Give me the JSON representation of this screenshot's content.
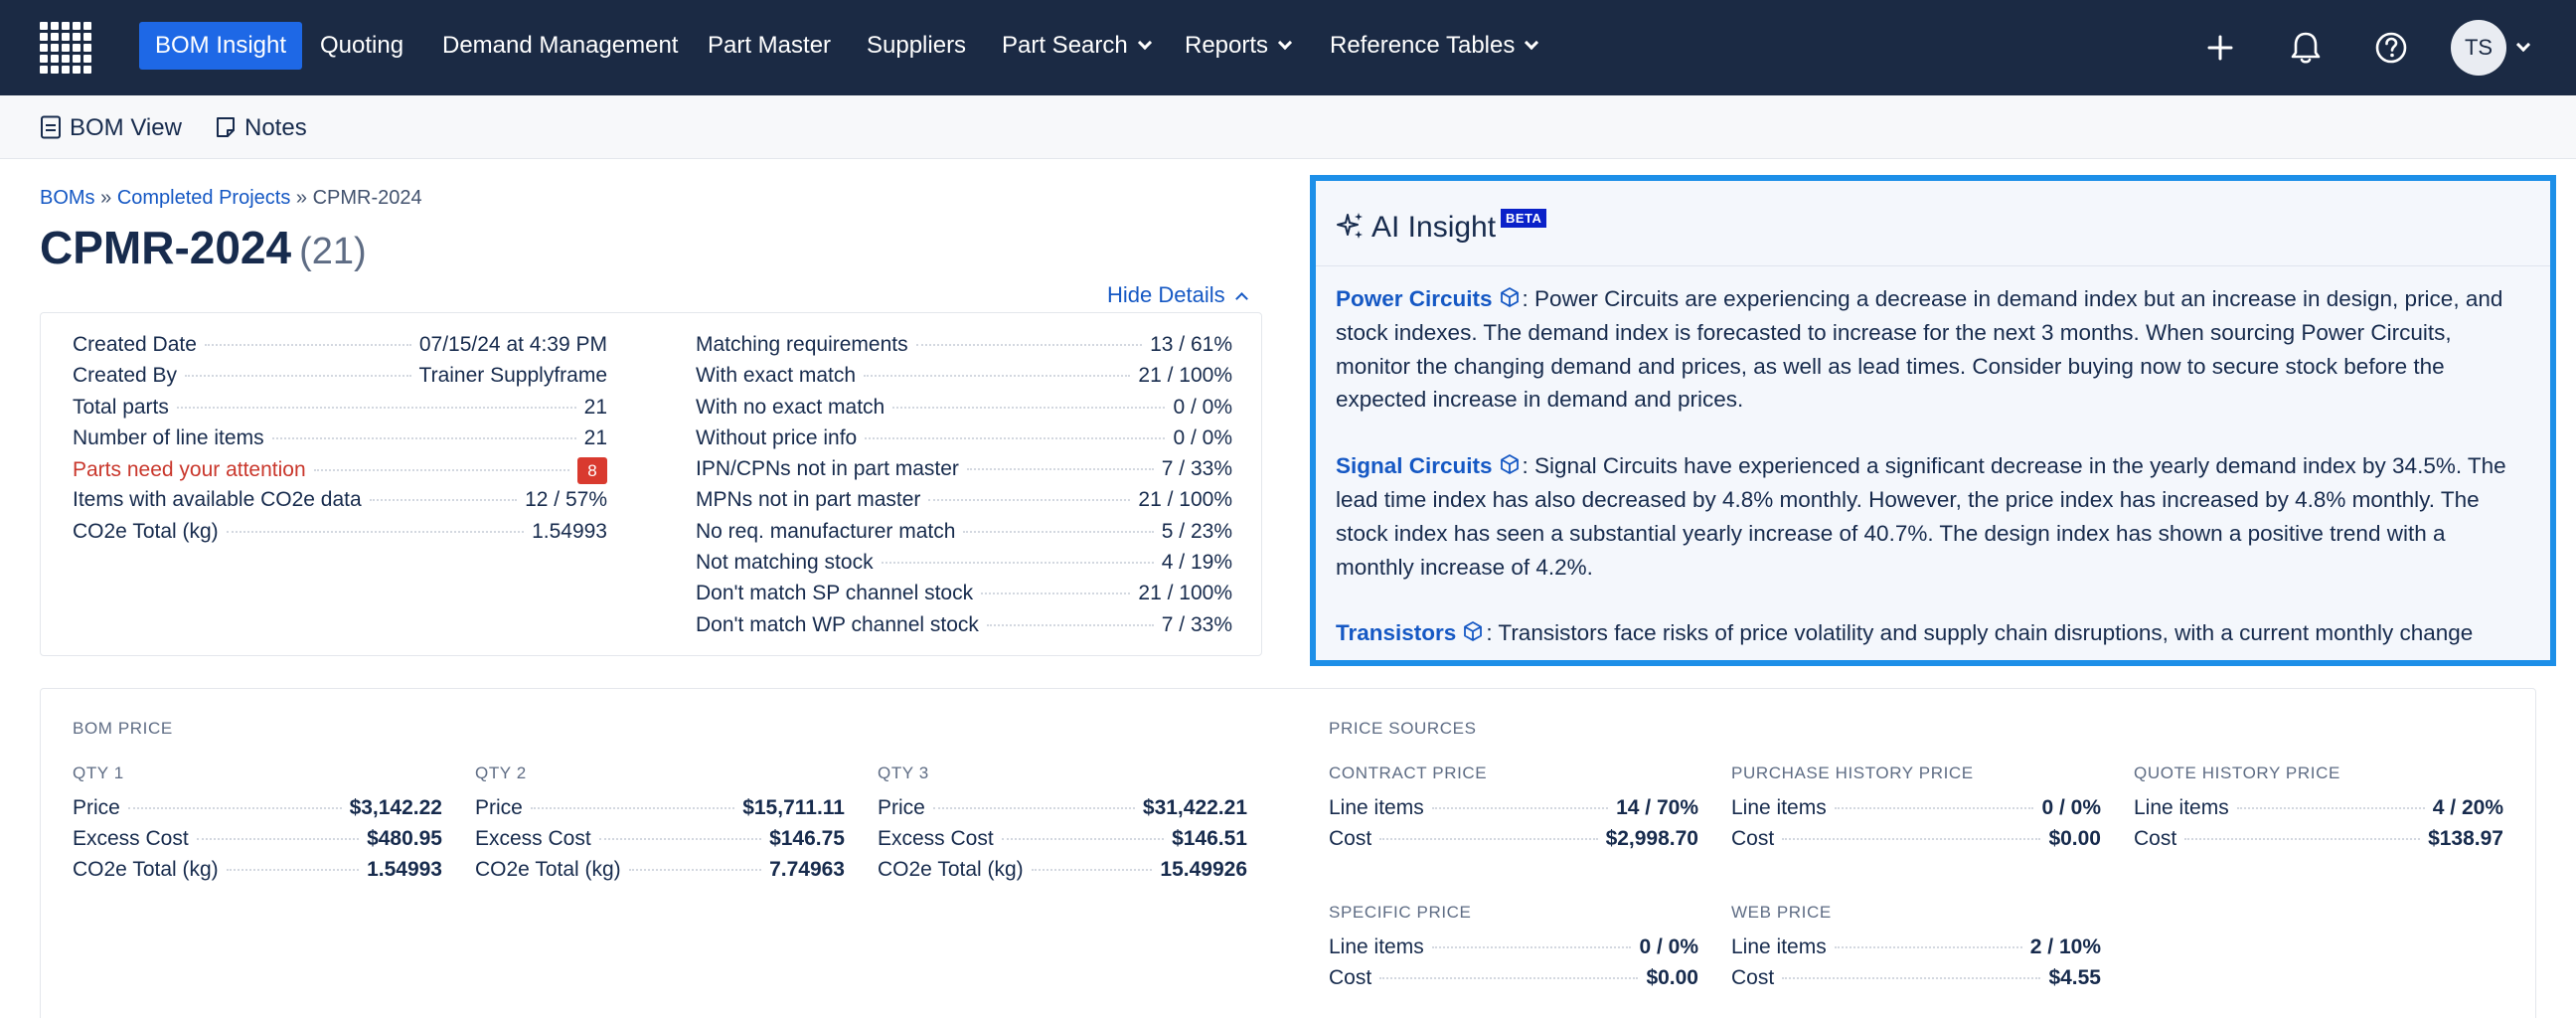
{
  "nav": {
    "items": [
      {
        "label": "BOM Insight",
        "active": true,
        "dropdown": false
      },
      {
        "label": "Quoting",
        "active": false,
        "dropdown": false
      },
      {
        "label": "Demand Management",
        "active": false,
        "dropdown": false
      },
      {
        "label": "Part Master",
        "active": false,
        "dropdown": false
      },
      {
        "label": "Suppliers",
        "active": false,
        "dropdown": false
      },
      {
        "label": "Part Search",
        "active": false,
        "dropdown": true
      },
      {
        "label": "Reports",
        "active": false,
        "dropdown": true
      },
      {
        "label": "Reference Tables",
        "active": false,
        "dropdown": true
      }
    ],
    "icons": [
      "plus-icon",
      "bell-icon",
      "help-icon"
    ],
    "avatar_initials": "TS",
    "accent_color": "#1e68e6",
    "bar_color": "#1b2a44"
  },
  "subnav": {
    "bom_view": "BOM View",
    "notes": "Notes"
  },
  "breadcrumb": {
    "root": "BOMs",
    "sep": "»",
    "parent": "Completed Projects",
    "current": "CPMR-2024"
  },
  "title": {
    "name": "CPMR-2024",
    "count": "(21)"
  },
  "hide_details": "Hide Details",
  "details": {
    "left": [
      {
        "label": "Created Date",
        "value": "07/15/24 at 4:39 PM"
      },
      {
        "label": "Created By",
        "value": "Trainer Supplyframe"
      },
      {
        "label": "Total parts",
        "value": "21"
      },
      {
        "label": "Number of line items",
        "value": "21"
      },
      {
        "label": "Parts need your attention",
        "value": "8",
        "attention": true
      },
      {
        "label": "Items with available CO2e data",
        "value": "12 / 57%"
      },
      {
        "label": "CO2e Total (kg)",
        "value": "1.54993"
      }
    ],
    "right": [
      {
        "label": "Matching requirements",
        "value": "13 / 61%"
      },
      {
        "label": "With exact match",
        "value": "21 / 100%"
      },
      {
        "label": "With no exact match",
        "value": "0 / 0%"
      },
      {
        "label": "Without price info",
        "value": "0 / 0%"
      },
      {
        "label": "IPN/CPNs not in part master",
        "value": "7 / 33%"
      },
      {
        "label": "MPNs not in part master",
        "value": "21 / 100%"
      },
      {
        "label": "No req. manufacturer match",
        "value": "5 / 23%"
      },
      {
        "label": "Not matching stock",
        "value": "4 / 19%"
      },
      {
        "label": "Don't match SP channel stock",
        "value": "21 / 100%"
      },
      {
        "label": "Don't match WP channel stock",
        "value": "7 / 33%"
      }
    ]
  },
  "ai_insight": {
    "title": "AI Insight",
    "badge": "BETA",
    "paragraphs": [
      {
        "category": "Power Circuits",
        "text": ": Power Circuits are experiencing a decrease in demand index but an increase in design, price, and stock indexes. The demand index is forecasted to increase for the next 3 months. When sourcing Power Circuits, monitor the changing demand and prices, as well as lead times. Consider buying now to secure stock before the expected increase in demand and prices."
      },
      {
        "category": "Signal Circuits",
        "text": ": Signal Circuits have experienced a significant decrease in the yearly demand index by 34.5%. The lead time index has also decreased by 4.8% monthly. However, the price index has increased by 4.8% monthly. The stock index has seen a substantial yearly increase of 40.7%. The design index has shown a positive trend with a monthly increase of 4.2%."
      },
      {
        "category": "Transistors",
        "text": ": Transistors face risks of price volatility and supply chain disruptions, with a current monthly change"
      }
    ],
    "border_color": "#1d8fe8"
  },
  "bom_price": {
    "label": "BOM PRICE",
    "qtys": [
      {
        "label": "QTY 1",
        "rows": [
          {
            "label": "Price",
            "value": "$3,142.22"
          },
          {
            "label": "Excess Cost",
            "value": "$480.95"
          },
          {
            "label": "CO2e Total (kg)",
            "value": "1.54993"
          }
        ]
      },
      {
        "label": "QTY 2",
        "rows": [
          {
            "label": "Price",
            "value": "$15,711.11"
          },
          {
            "label": "Excess Cost",
            "value": "$146.75"
          },
          {
            "label": "CO2e Total (kg)",
            "value": "7.74963"
          }
        ]
      },
      {
        "label": "QTY 3",
        "rows": [
          {
            "label": "Price",
            "value": "$31,422.21"
          },
          {
            "label": "Excess Cost",
            "value": "$146.51"
          },
          {
            "label": "CO2e Total (kg)",
            "value": "15.49926"
          }
        ]
      }
    ]
  },
  "price_sources": {
    "label": "PRICE SOURCES",
    "sources": [
      {
        "label": "CONTRACT PRICE",
        "rows": [
          {
            "label": "Line items",
            "value": "14 / 70%"
          },
          {
            "label": "Cost",
            "value": "$2,998.70"
          }
        ]
      },
      {
        "label": "PURCHASE HISTORY PRICE",
        "rows": [
          {
            "label": "Line items",
            "value": "0 / 0%"
          },
          {
            "label": "Cost",
            "value": "$0.00"
          }
        ]
      },
      {
        "label": "QUOTE HISTORY PRICE",
        "rows": [
          {
            "label": "Line items",
            "value": "4 / 20%"
          },
          {
            "label": "Cost",
            "value": "$138.97"
          }
        ]
      },
      {
        "label": "SPECIFIC PRICE",
        "rows": [
          {
            "label": "Line items",
            "value": "0 / 0%"
          },
          {
            "label": "Cost",
            "value": "$0.00"
          }
        ]
      },
      {
        "label": "WEB PRICE",
        "rows": [
          {
            "label": "Line items",
            "value": "2 / 10%"
          },
          {
            "label": "Cost",
            "value": "$4.55"
          }
        ]
      }
    ]
  }
}
